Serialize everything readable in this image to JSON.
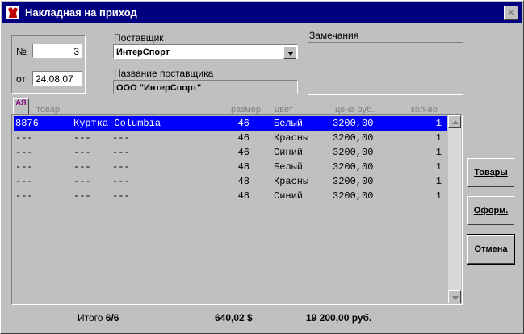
{
  "window": {
    "title": "Накладная на приход"
  },
  "doc": {
    "number_label": "№",
    "number_value": "3",
    "date_label": "от",
    "date_value": "24.08.07"
  },
  "supplier": {
    "label": "Поставщик",
    "value": "ИнтерСпорт",
    "name_label": "Название поставщика",
    "name_value": "ООО \"ИнтерСпорт\""
  },
  "remarks": {
    "label": "Замечания",
    "value": ""
  },
  "table": {
    "sort_icon_text": "АЯ",
    "columns": {
      "item": "товар",
      "size": "размер",
      "color": "цвет",
      "price": "цена руб.",
      "qty": "кол-во"
    },
    "rows": [
      {
        "code": "8876",
        "name": "Куртка Columbia",
        "c3": "",
        "size": "46",
        "color": "Белый",
        "price": "3200,00",
        "qty": "1"
      },
      {
        "code": "---",
        "name": "---",
        "c3": "---",
        "size": "46",
        "color": "Красны",
        "price": "3200,00",
        "qty": "1"
      },
      {
        "code": "---",
        "name": "---",
        "c3": "---",
        "size": "46",
        "color": "Синий",
        "price": "3200,00",
        "qty": "1"
      },
      {
        "code": "---",
        "name": "---",
        "c3": "---",
        "size": "48",
        "color": "Белый",
        "price": "3200,00",
        "qty": "1"
      },
      {
        "code": "---",
        "name": "---",
        "c3": "---",
        "size": "48",
        "color": "Красны",
        "price": "3200,00",
        "qty": "1"
      },
      {
        "code": "---",
        "name": "---",
        "c3": "---",
        "size": "48",
        "color": "Синий",
        "price": "3200,00",
        "qty": "1"
      }
    ]
  },
  "buttons": {
    "goods": "Товары",
    "process": "Оформ.",
    "cancel": "Отмена"
  },
  "totals": {
    "label": "Итого",
    "count": "6/6",
    "usd": "640,02 $",
    "rub": "19 200,00 руб."
  }
}
